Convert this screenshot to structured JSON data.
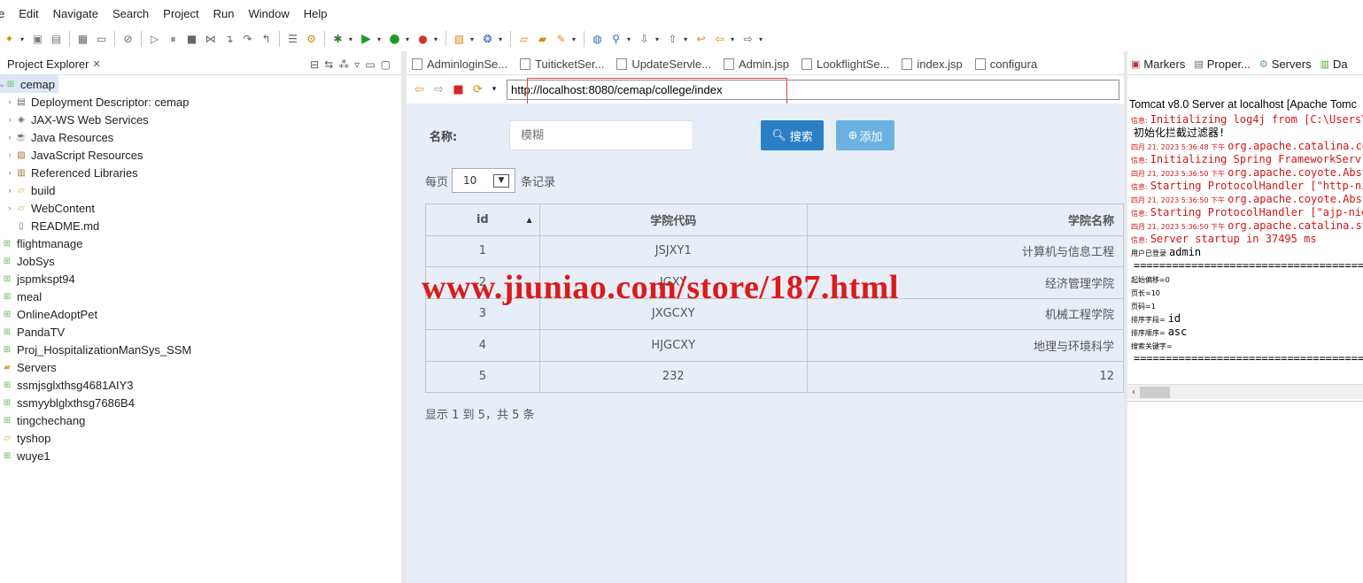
{
  "menu": [
    "e",
    "Edit",
    "Navigate",
    "Search",
    "Project",
    "Run",
    "Window",
    "Help"
  ],
  "left_panel": {
    "title": "Project Explorer",
    "close": "✕",
    "tree": [
      {
        "label": "cemap",
        "level": 0,
        "expanded": true,
        "selected": true,
        "icon": "project-icon"
      },
      {
        "label": "Deployment Descriptor: cemap",
        "level": 1,
        "icon": "descriptor-icon"
      },
      {
        "label": "JAX-WS Web Services",
        "level": 1,
        "icon": "webservice-icon"
      },
      {
        "label": "Java Resources",
        "level": 1,
        "icon": "java-resources-icon"
      },
      {
        "label": "JavaScript Resources",
        "level": 1,
        "icon": "javascript-resources-icon"
      },
      {
        "label": "Referenced Libraries",
        "level": 1,
        "icon": "library-icon"
      },
      {
        "label": "build",
        "level": 1,
        "icon": "folder-icon"
      },
      {
        "label": "WebContent",
        "level": 1,
        "icon": "folder-icon"
      },
      {
        "label": "README.md",
        "level": 1,
        "icon": "file-icon",
        "leaf": true
      },
      {
        "label": "flightmanage",
        "level": 0,
        "icon": "project-icon"
      },
      {
        "label": "JobSys",
        "level": 0,
        "icon": "project-icon"
      },
      {
        "label": "jspmkspt94",
        "level": 0,
        "icon": "project-icon"
      },
      {
        "label": "meal",
        "level": 0,
        "icon": "project-icon"
      },
      {
        "label": "OnlineAdoptPet",
        "level": 0,
        "icon": "project-icon"
      },
      {
        "label": "PandaTV",
        "level": 0,
        "icon": "project-icon"
      },
      {
        "label": "Proj_HospitalizationManSys_SSM",
        "level": 0,
        "icon": "project-icon"
      },
      {
        "label": "Servers",
        "level": 0,
        "icon": "servers-icon"
      },
      {
        "label": "ssmjsglxthsg4681AIY3",
        "level": 0,
        "icon": "project-icon"
      },
      {
        "label": "ssmyyblglxthsg7686B4",
        "level": 0,
        "icon": "project-icon"
      },
      {
        "label": "tingchechang",
        "level": 0,
        "icon": "project-icon"
      },
      {
        "label": "tyshop",
        "level": 0,
        "icon": "folder-icon"
      },
      {
        "label": "wuye1",
        "level": 0,
        "icon": "project-icon"
      }
    ]
  },
  "editor": {
    "tabs": [
      "AdminloginSe...",
      "TuiticketSer...",
      "UpdateServle...",
      "Admin.jsp",
      "LookflightSe...",
      "index.jsp",
      "configura"
    ],
    "url": "http://localhost:8080/cemap/college/index"
  },
  "page": {
    "search_label": "名称:",
    "search_placeholder": "模糊",
    "search_button": "搜索",
    "add_button": "添加",
    "per_page_prefix": "每页",
    "per_page_value": "10",
    "per_page_suffix": "条记录",
    "columns": [
      "id",
      "学院代码",
      "学院名称"
    ],
    "rows": [
      {
        "id": "1",
        "code": "JSJXY1",
        "name": "计算机与信息工程"
      },
      {
        "id": "2",
        "code": "JGXY",
        "name": "经济管理学院"
      },
      {
        "id": "3",
        "code": "JXGCXY",
        "name": "机械工程学院"
      },
      {
        "id": "4",
        "code": "HJGCXY",
        "name": "地理与环境科学"
      },
      {
        "id": "5",
        "code": "232",
        "name": "12"
      }
    ],
    "pagination": "显示 1 到 5，共 5 条"
  },
  "watermark": "www.jiuniao.com/store/187.html",
  "right_panel": {
    "tabs": [
      "Markers",
      "Proper...",
      "Servers",
      "Da"
    ],
    "console_title": "Tomcat v8.0 Server at localhost [Apache Tomc",
    "lines": [
      {
        "type": "err",
        "prefix": "信息:",
        "text": "Initializing log4j from [C:\\Users\\"
      },
      {
        "type": "blk",
        "prefix": "",
        "text": "初始化拦截过滤器!"
      },
      {
        "type": "err",
        "prefix": "四月 21, 2023 5:36:48 下午",
        "text": "org.apache.catalina.co"
      },
      {
        "type": "err",
        "prefix": "信息:",
        "text": "Initializing Spring FrameworkServl"
      },
      {
        "type": "err",
        "prefix": "四月 21, 2023 5:36:50 下午",
        "text": "org.apache.coyote.Abst"
      },
      {
        "type": "err",
        "prefix": "信息:",
        "text": "Starting ProtocolHandler [\"http-nio"
      },
      {
        "type": "err",
        "prefix": "四月 21, 2023 5:36:50 下午",
        "text": "org.apache.coyote.Abst"
      },
      {
        "type": "err",
        "prefix": "信息:",
        "text": "Starting ProtocolHandler [\"ajp-nio"
      },
      {
        "type": "err",
        "prefix": "四月 21, 2023 5:36:50 下午",
        "text": "org.apache.catalina.st"
      },
      {
        "type": "err",
        "prefix": "信息:",
        "text": "Server startup in 37495 ms"
      },
      {
        "type": "blk",
        "prefix": "用户已登录",
        "text": "admin"
      },
      {
        "type": "blk",
        "prefix": "",
        "text": "====================================="
      },
      {
        "type": "blk",
        "prefix": "起始偏移=0",
        "text": ""
      },
      {
        "type": "blk",
        "prefix": "页长=10",
        "text": ""
      },
      {
        "type": "blk",
        "prefix": "页码=1",
        "text": ""
      },
      {
        "type": "blk",
        "prefix": "排序字段=",
        "text": "id"
      },
      {
        "type": "blk",
        "prefix": "排序顺序=",
        "text": "asc"
      },
      {
        "type": "blk",
        "prefix": "搜索关键字=",
        "text": ""
      },
      {
        "type": "blk",
        "prefix": "",
        "text": "====================================="
      }
    ]
  },
  "colors": {
    "search_button": "#2b7fc4",
    "add_button": "#6ab2e2",
    "console_error": "#d01616",
    "page_bg": "#e8eef8",
    "url_highlight": "#dd4444",
    "watermark": "#dd1a1a"
  }
}
